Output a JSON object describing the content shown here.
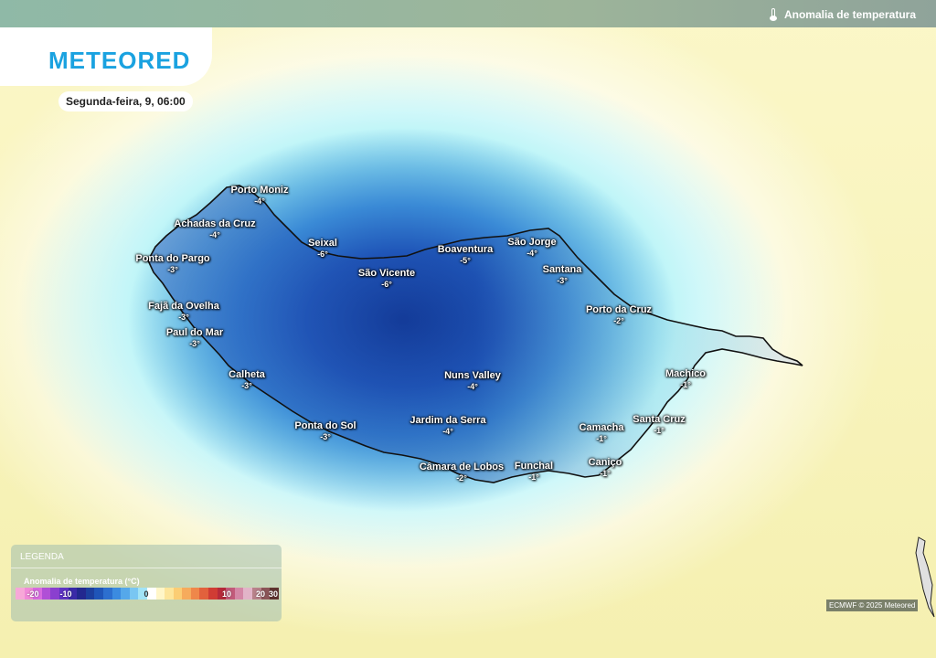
{
  "header": {
    "layer_title": "Anomalia de temperatura",
    "layer_icon": "thermometer-icon"
  },
  "brand": {
    "logo": "METEORED"
  },
  "forecast": {
    "datetime": "Segunda-feira, 9, 06:00"
  },
  "places": [
    {
      "name": "Porto Moniz",
      "temp": "-4°"
    },
    {
      "name": "Achadas da Cruz",
      "temp": "-4°"
    },
    {
      "name": "Ponta do Pargo",
      "temp": "-3°"
    },
    {
      "name": "Fajã da Ovelha",
      "temp": "-3°"
    },
    {
      "name": "Paul do Mar",
      "temp": "-3°"
    },
    {
      "name": "Calheta",
      "temp": "-3°"
    },
    {
      "name": "Seixal",
      "temp": "-6°"
    },
    {
      "name": "São Vicente",
      "temp": "-6°"
    },
    {
      "name": "Boaventura",
      "temp": "-5°"
    },
    {
      "name": "São Jorge",
      "temp": "-4°"
    },
    {
      "name": "Santana",
      "temp": "-3°"
    },
    {
      "name": "Porto da Cruz",
      "temp": "-2°"
    },
    {
      "name": "Machico",
      "temp": "-1°"
    },
    {
      "name": "Santa Cruz",
      "temp": "-1°"
    },
    {
      "name": "Camacha",
      "temp": "-1°"
    },
    {
      "name": "Caniço",
      "temp": "-1°"
    },
    {
      "name": "Funchal",
      "temp": "-1°"
    },
    {
      "name": "Câmara de Lobos",
      "temp": "-2°"
    },
    {
      "name": "Jardim da Serra",
      "temp": "-4°"
    },
    {
      "name": "Nuns Valley",
      "temp": "-4°"
    },
    {
      "name": "Ponta do Sol",
      "temp": "-3°"
    }
  ],
  "legend": {
    "title": "LEGENDA",
    "subtitle": "Anomalia de temperatura (°C)",
    "ticks": [
      "-20",
      "-10",
      "0",
      "10",
      "20",
      "30"
    ],
    "colors": [
      "#f7a8d8",
      "#f08ad8",
      "#d86be0",
      "#b04fd6",
      "#8a3fcf",
      "#5f34c4",
      "#3a2aa8",
      "#23288f",
      "#1c3f9e",
      "#1f55b8",
      "#2c6fcf",
      "#3b8be0",
      "#55a8ea",
      "#79c6f2",
      "#a2e3f6",
      "#ffffff",
      "#fff6c8",
      "#fde59a",
      "#fbcd74",
      "#f6ab5c",
      "#ef874a",
      "#e2613c",
      "#d03c34",
      "#b62a3a",
      "#c25a7a",
      "#d487a6",
      "#e2b4c8",
      "#b8828a",
      "#8c5558",
      "#5f3330"
    ]
  },
  "credit": "ECMWF © 2025 Meteored"
}
